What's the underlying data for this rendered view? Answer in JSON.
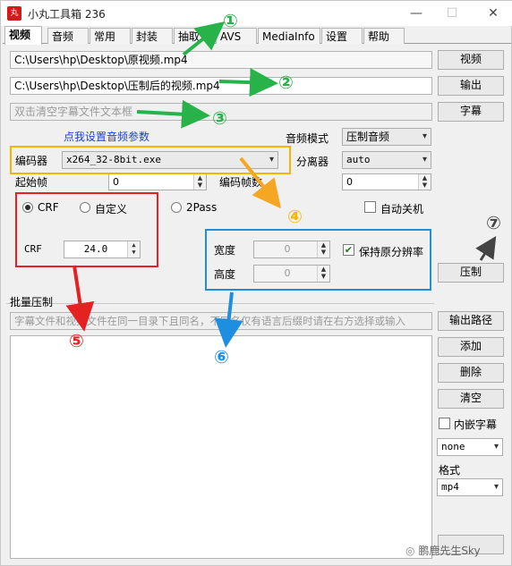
{
  "window": {
    "title": "小丸工具箱 236",
    "icon_label": "丸"
  },
  "tabs": [
    "视频",
    "音频",
    "常用",
    "封装",
    "抽取",
    "AVS",
    "MediaInfo",
    "设置",
    "帮助"
  ],
  "paths": {
    "source_video": "C:\\Users\\hp\\Desktop\\原视频.mp4",
    "output_video": "C:\\Users\\hp\\Desktop\\压制后的视频.mp4",
    "subtitle_placeholder": "双击清空字幕文件文本框"
  },
  "buttons": {
    "video": "视频",
    "output": "输出",
    "subtitle": "字幕",
    "encode": "压制",
    "output_path": "输出路径",
    "add": "添加",
    "delete": "删除",
    "clear": "清空"
  },
  "audio": {
    "settings_link": "点我设置音频参数",
    "mode_label": "音频模式",
    "mode_value": "压制音频"
  },
  "encoder": {
    "label": "编码器",
    "value": "x264_32-8bit.exe",
    "demuxer_label": "分离器",
    "demuxer_value": "auto",
    "start_frame_label": "起始帧",
    "start_frame_value": "0",
    "encode_frames_label": "编码帧数",
    "encode_frames_value": "0"
  },
  "rate_mode": {
    "crf_label": "CRF",
    "custom_label": "自定义",
    "twopass_label": "2Pass",
    "crf_value_label": "CRF",
    "crf_value": "24.0",
    "auto_shutdown_label": "自动关机"
  },
  "resolution": {
    "width_label": "宽度",
    "width_value": "0",
    "height_label": "高度",
    "height_value": "0",
    "keep_label": "保持原分辨率"
  },
  "batch": {
    "label": "批量压制",
    "hint": "字幕文件和视频文件在同一目录下且同名，不同名仅有语言后缀时请在右方选择或输入",
    "embed_sub_label": "内嵌字幕",
    "sub_lang_value": "none",
    "format_label": "格式",
    "format_value": "mp4"
  },
  "annotations": {
    "markers": [
      "①",
      "②",
      "③",
      "④",
      "⑤",
      "⑥",
      "⑦"
    ],
    "colors": {
      "green": "#27b34a",
      "yellow": "#f5b400",
      "red": "#e52222",
      "blue": "#1e8ee0",
      "gray": "#444444",
      "orange_arrow": "#f5a623"
    }
  },
  "watermark": "鹏鹿先生Sky"
}
